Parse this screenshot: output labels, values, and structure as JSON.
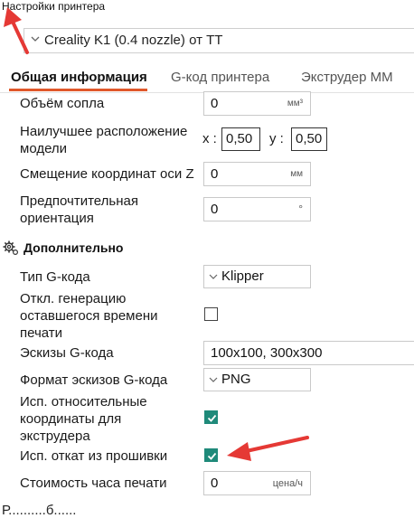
{
  "window": {
    "title": "Настройки принтера"
  },
  "printer": {
    "selected": "Creality K1 (0.4 nozzle) от ТТ"
  },
  "tabs": [
    {
      "label": "Общая информация",
      "active": true
    },
    {
      "label": "G-код принтера",
      "active": false
    },
    {
      "label": "Экструдер ММ",
      "active": false
    }
  ],
  "general": {
    "nozzle_volume": {
      "label": "Объём сопла",
      "value": "0",
      "unit": "мм³"
    },
    "best_position": {
      "label": "Наилучшее расположение модели",
      "x_label": "x :",
      "x_value": "0,50",
      "y_label": "y :",
      "y_value": "0,50"
    },
    "z_offset": {
      "label": "Смещение координат оси Z",
      "value": "0",
      "unit": "мм"
    },
    "preferred_orientation": {
      "label": "Предпочтительная ориентация",
      "value": "0",
      "unit": "°"
    }
  },
  "advanced": {
    "title": "Дополнительно",
    "gcode_type": {
      "label": "Тип G-кода",
      "value": "Klipper"
    },
    "disable_remaining_time": {
      "label": "Откл. генерацию оставшегося времени печати",
      "checked": false
    },
    "thumbnails": {
      "label": "Эскизы G-кода",
      "value": "100x100, 300x300"
    },
    "thumbnail_format": {
      "label": "Формат эскизов G-кода",
      "value": "PNG"
    },
    "relative_extrusion": {
      "label": "Исп. относительные координаты для экструдера",
      "checked": true
    },
    "firmware_retraction": {
      "label": "Исп. откат из прошивки",
      "checked": true
    },
    "hourly_cost": {
      "label": "Стоимость часа печати",
      "value": "0",
      "unit": "цена/ч"
    }
  },
  "footer_partial": "Р..........б......",
  "colors": {
    "accent": "#e0582b",
    "check": "#1f8a7a",
    "annotation": "#e53935"
  }
}
